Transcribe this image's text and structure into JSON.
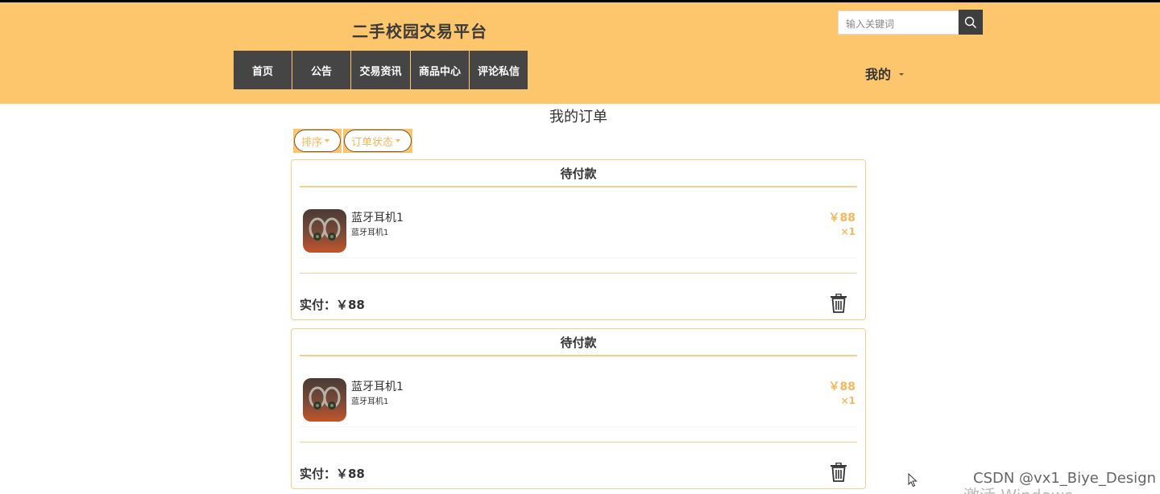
{
  "header": {
    "site_title": "二手校园交易平台",
    "search_placeholder": "输入关键词",
    "nav": [
      "首页",
      "公告",
      "交易资讯",
      "商品中心",
      "评论私信"
    ],
    "my_menu": "我的"
  },
  "page": {
    "title": "我的订单",
    "filters": [
      "排序",
      "订单状态"
    ]
  },
  "orders": [
    {
      "status": "待付款",
      "item_name": "蓝牙耳机1",
      "item_sub": "蓝牙耳机1",
      "price": "￥88",
      "qty": "×1",
      "paid": "实付：￥88"
    },
    {
      "status": "待付款",
      "item_name": "蓝牙耳机1",
      "item_sub": "蓝牙耳机1",
      "price": "￥88",
      "qty": "×1",
      "paid": "实付：￥88"
    }
  ],
  "overlay": {
    "watermark": "CSDN @vx1_Biye_Design",
    "activate_windows": "激活 Windows"
  },
  "colors": {
    "header_bg": "#fdc66c",
    "nav_bg": "#454545",
    "accent": "#f6b75a",
    "border": "#f4cf8c"
  },
  "icons": [
    "search-icon",
    "caret-down-icon",
    "trash-icon",
    "mouse-cursor-icon"
  ]
}
